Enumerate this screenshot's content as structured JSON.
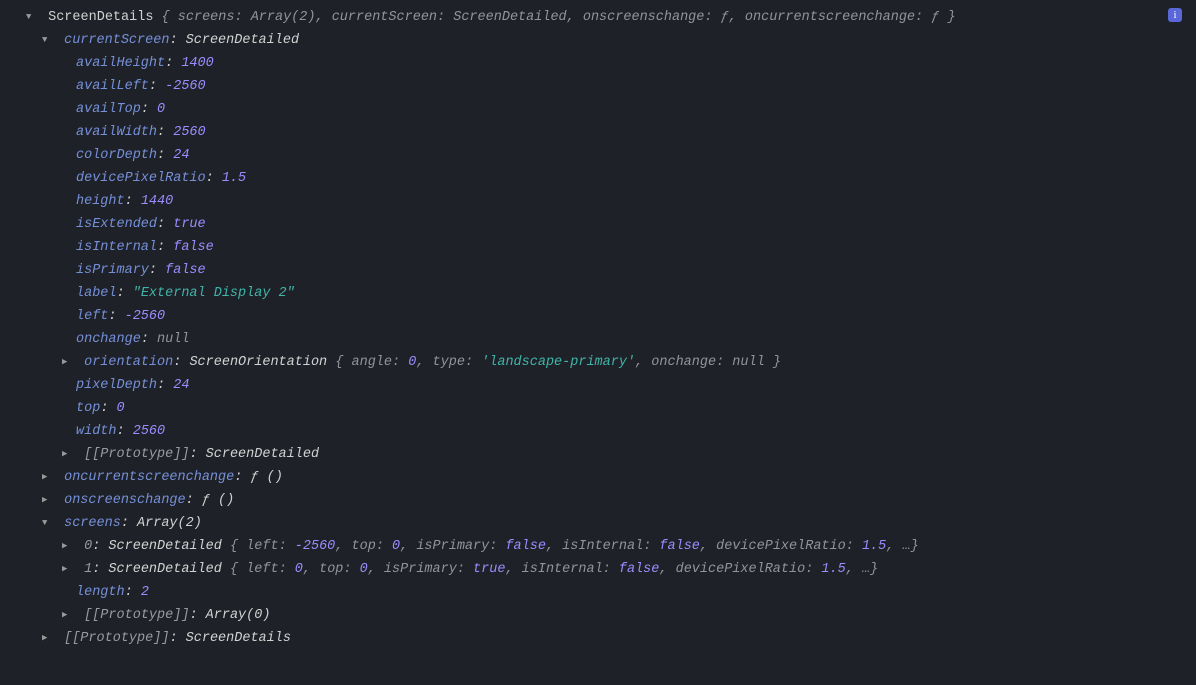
{
  "root": {
    "name": "ScreenDetails",
    "summary": {
      "screens": {
        "k": "screens",
        "v": "Array(2)"
      },
      "currentScreen": {
        "k": "currentScreen",
        "v": "ScreenDetailed"
      },
      "onscreenschange": {
        "k": "onscreenschange",
        "v": "ƒ"
      },
      "oncurrentscreenchange": {
        "k": "oncurrentscreenchange",
        "v": "ƒ"
      }
    }
  },
  "cs": {
    "label": "currentScreen",
    "type": "ScreenDetailed",
    "props": {
      "availHeight": {
        "k": "availHeight",
        "v": "1400",
        "t": "num"
      },
      "availLeft": {
        "k": "availLeft",
        "v": "-2560",
        "t": "num"
      },
      "availTop": {
        "k": "availTop",
        "v": "0",
        "t": "num"
      },
      "availWidth": {
        "k": "availWidth",
        "v": "2560",
        "t": "num"
      },
      "colorDepth": {
        "k": "colorDepth",
        "v": "24",
        "t": "num"
      },
      "devicePixelRatio": {
        "k": "devicePixelRatio",
        "v": "1.5",
        "t": "num"
      },
      "height": {
        "k": "height",
        "v": "1440",
        "t": "num"
      },
      "isExtended": {
        "k": "isExtended",
        "v": "true",
        "t": "bool"
      },
      "isInternal": {
        "k": "isInternal",
        "v": "false",
        "t": "bool"
      },
      "isPrimary": {
        "k": "isPrimary",
        "v": "false",
        "t": "bool"
      },
      "label": {
        "k": "label",
        "v": "\"External Display 2\"",
        "t": "str"
      },
      "left": {
        "k": "left",
        "v": "-2560",
        "t": "num"
      },
      "onchange": {
        "k": "onchange",
        "v": "null",
        "t": "nul"
      }
    },
    "orientation": {
      "k": "orientation",
      "type": "ScreenOrientation",
      "angle": {
        "k": "angle",
        "v": "0"
      },
      "otype": {
        "k": "type",
        "v": "'landscape-primary'"
      },
      "onchange": {
        "k": "onchange",
        "v": "null"
      }
    },
    "after": {
      "pixelDepth": {
        "k": "pixelDepth",
        "v": "24",
        "t": "num"
      },
      "top": {
        "k": "top",
        "v": "0",
        "t": "num"
      },
      "width": {
        "k": "width",
        "v": "2560",
        "t": "num"
      }
    },
    "proto": {
      "k": "[[Prototype]]",
      "v": "ScreenDetailed"
    }
  },
  "oncurrent": {
    "k": "oncurrentscreenchange",
    "v": "ƒ ()"
  },
  "onscr": {
    "k": "onscreenschange",
    "v": "ƒ ()"
  },
  "screens": {
    "k": "screens",
    "type": "Array(2)",
    "row0": {
      "idx": "0",
      "type": "ScreenDetailed",
      "left": {
        "k": "left",
        "v": "-2560"
      },
      "top": {
        "k": "top",
        "v": "0"
      },
      "isPrimary": {
        "k": "isPrimary",
        "v": "false"
      },
      "isInternal": {
        "k": "isInternal",
        "v": "false"
      },
      "dpr": {
        "k": "devicePixelRatio",
        "v": "1.5"
      },
      "more": "…"
    },
    "row1": {
      "idx": "1",
      "type": "ScreenDetailed",
      "left": {
        "k": "left",
        "v": "0"
      },
      "top": {
        "k": "top",
        "v": "0"
      },
      "isPrimary": {
        "k": "isPrimary",
        "v": "true"
      },
      "isInternal": {
        "k": "isInternal",
        "v": "false"
      },
      "dpr": {
        "k": "devicePixelRatio",
        "v": "1.5"
      },
      "more": "…"
    },
    "length": {
      "k": "length",
      "v": "2"
    },
    "proto": {
      "k": "[[Prototype]]",
      "v": "Array(0)"
    }
  },
  "rootProto": {
    "k": "[[Prototype]]",
    "v": "ScreenDetails"
  },
  "glyph": {
    "down": "▼",
    "right": "▶",
    "info": "i"
  },
  "punc": {
    "ob": "{",
    "cb": "}",
    "colon": ": ",
    "comma": ", "
  }
}
